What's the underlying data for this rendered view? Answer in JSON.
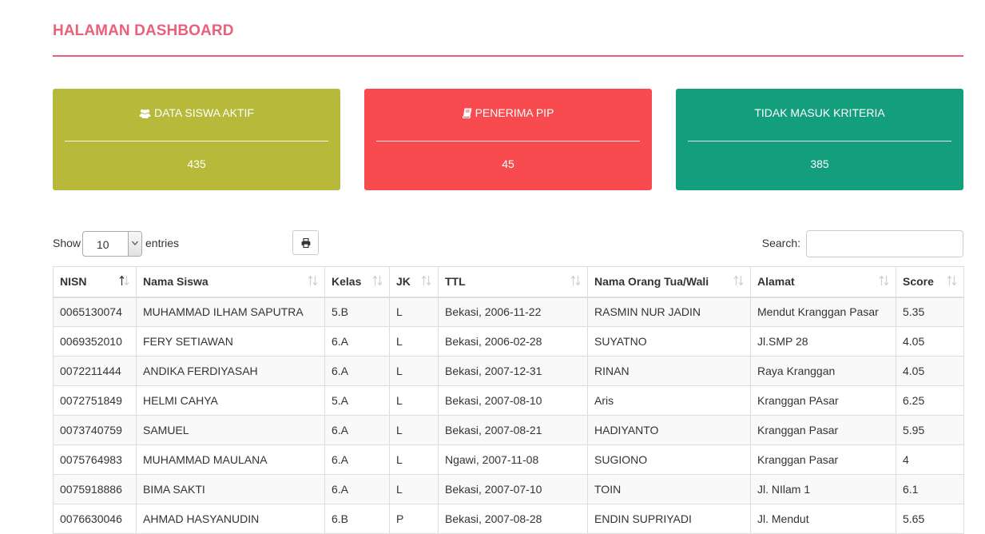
{
  "header": {
    "title": "HALAMAN DASHBOARD"
  },
  "cards": [
    {
      "icon": "users-icon",
      "label": "DATA SISWA AKTIF",
      "value": "435",
      "color": "#b7b93a"
    },
    {
      "icon": "book-icon",
      "label": "PENERIMA PIP",
      "value": "45",
      "color": "#f74b4f"
    },
    {
      "icon": "",
      "label": "TIDAK MASUK KRITERIA",
      "value": "385",
      "color": "#139e7e"
    }
  ],
  "controls": {
    "show_label": "Show",
    "entries_value": "10",
    "entries_label": "entries",
    "search_label": "Search:",
    "search_value": "",
    "print_icon": "print-icon"
  },
  "table": {
    "columns": [
      "NISN",
      "Nama Siswa",
      "Kelas",
      "JK",
      "TTL",
      "Nama Orang Tua/Wali",
      "Alamat",
      "Score"
    ],
    "rows": [
      [
        "0065130074",
        "MUHAMMAD ILHAM SAPUTRA",
        "5.B",
        "L",
        "Bekasi, 2006-11-22",
        "RASMIN NUR JADIN",
        "Mendut Kranggan Pasar",
        "5.35"
      ],
      [
        "0069352010",
        "FERY SETIAWAN",
        "6.A",
        "L",
        "Bekasi, 2006-02-28",
        "SUYATNO",
        "Jl.SMP 28",
        "4.05"
      ],
      [
        "0072211444",
        "ANDIKA FERDIYASAH",
        "6.A",
        "L",
        "Bekasi, 2007-12-31",
        "RINAN",
        "Raya Kranggan",
        "4.05"
      ],
      [
        "0072751849",
        "HELMI CAHYA",
        "5.A",
        "L",
        "Bekasi, 2007-08-10",
        "Aris",
        "Kranggan PAsar",
        "6.25"
      ],
      [
        "0073740759",
        "SAMUEL",
        "6.A",
        "L",
        "Bekasi, 2007-08-21",
        "HADIYANTO",
        "Kranggan Pasar",
        "5.95"
      ],
      [
        "0075764983",
        "MUHAMMAD MAULANA",
        "6.A",
        "L",
        "Ngawi, 2007-11-08",
        "SUGIONO",
        "Kranggan Pasar",
        "4"
      ],
      [
        "0075918886",
        "BIMA SAKTI",
        "6.A",
        "L",
        "Bekasi, 2007-07-10",
        "TOIN",
        "Jl. NIlam 1",
        "6.1"
      ],
      [
        "0076630046",
        "AHMAD HASYANUDIN",
        "6.B",
        "P",
        "Bekasi, 2007-08-28",
        "ENDIN SUPRIYADI",
        "Jl. Mendut",
        "5.65"
      ]
    ]
  }
}
